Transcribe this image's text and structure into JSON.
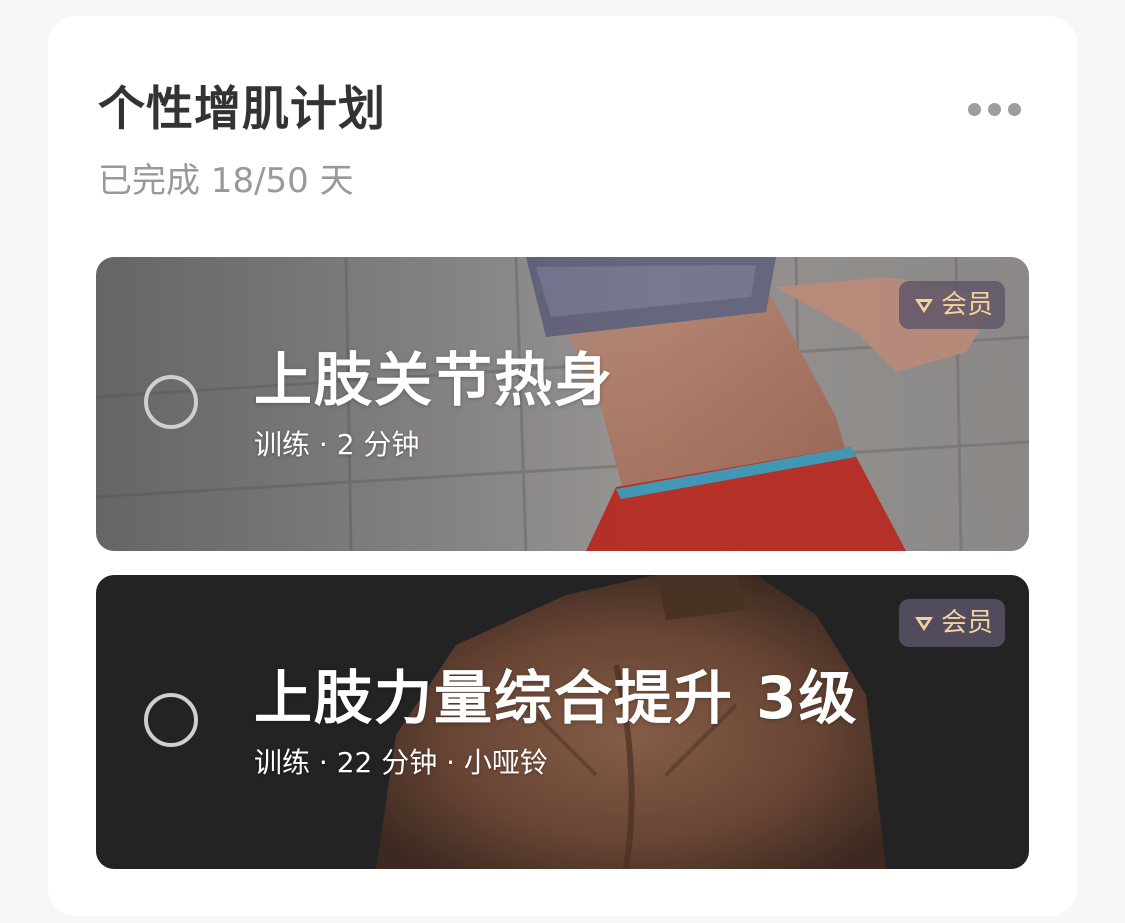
{
  "plan": {
    "title": "个性增肌计划",
    "progress": "已完成 18/50 天"
  },
  "more_icon": "ellipsis-icon",
  "workouts": [
    {
      "title": "上肢关节热身",
      "meta": "训练 · 2 分钟",
      "badge": "会员",
      "completed": false
    },
    {
      "title": "上肢力量综合提升 3级",
      "meta": "训练 · 22 分钟 · 小哑铃",
      "badge": "会员",
      "completed": false
    }
  ],
  "colors": {
    "badge_text": "#f2d39b",
    "badge_bg": "#5c5468",
    "title": "#333333",
    "subtitle": "#999999"
  }
}
